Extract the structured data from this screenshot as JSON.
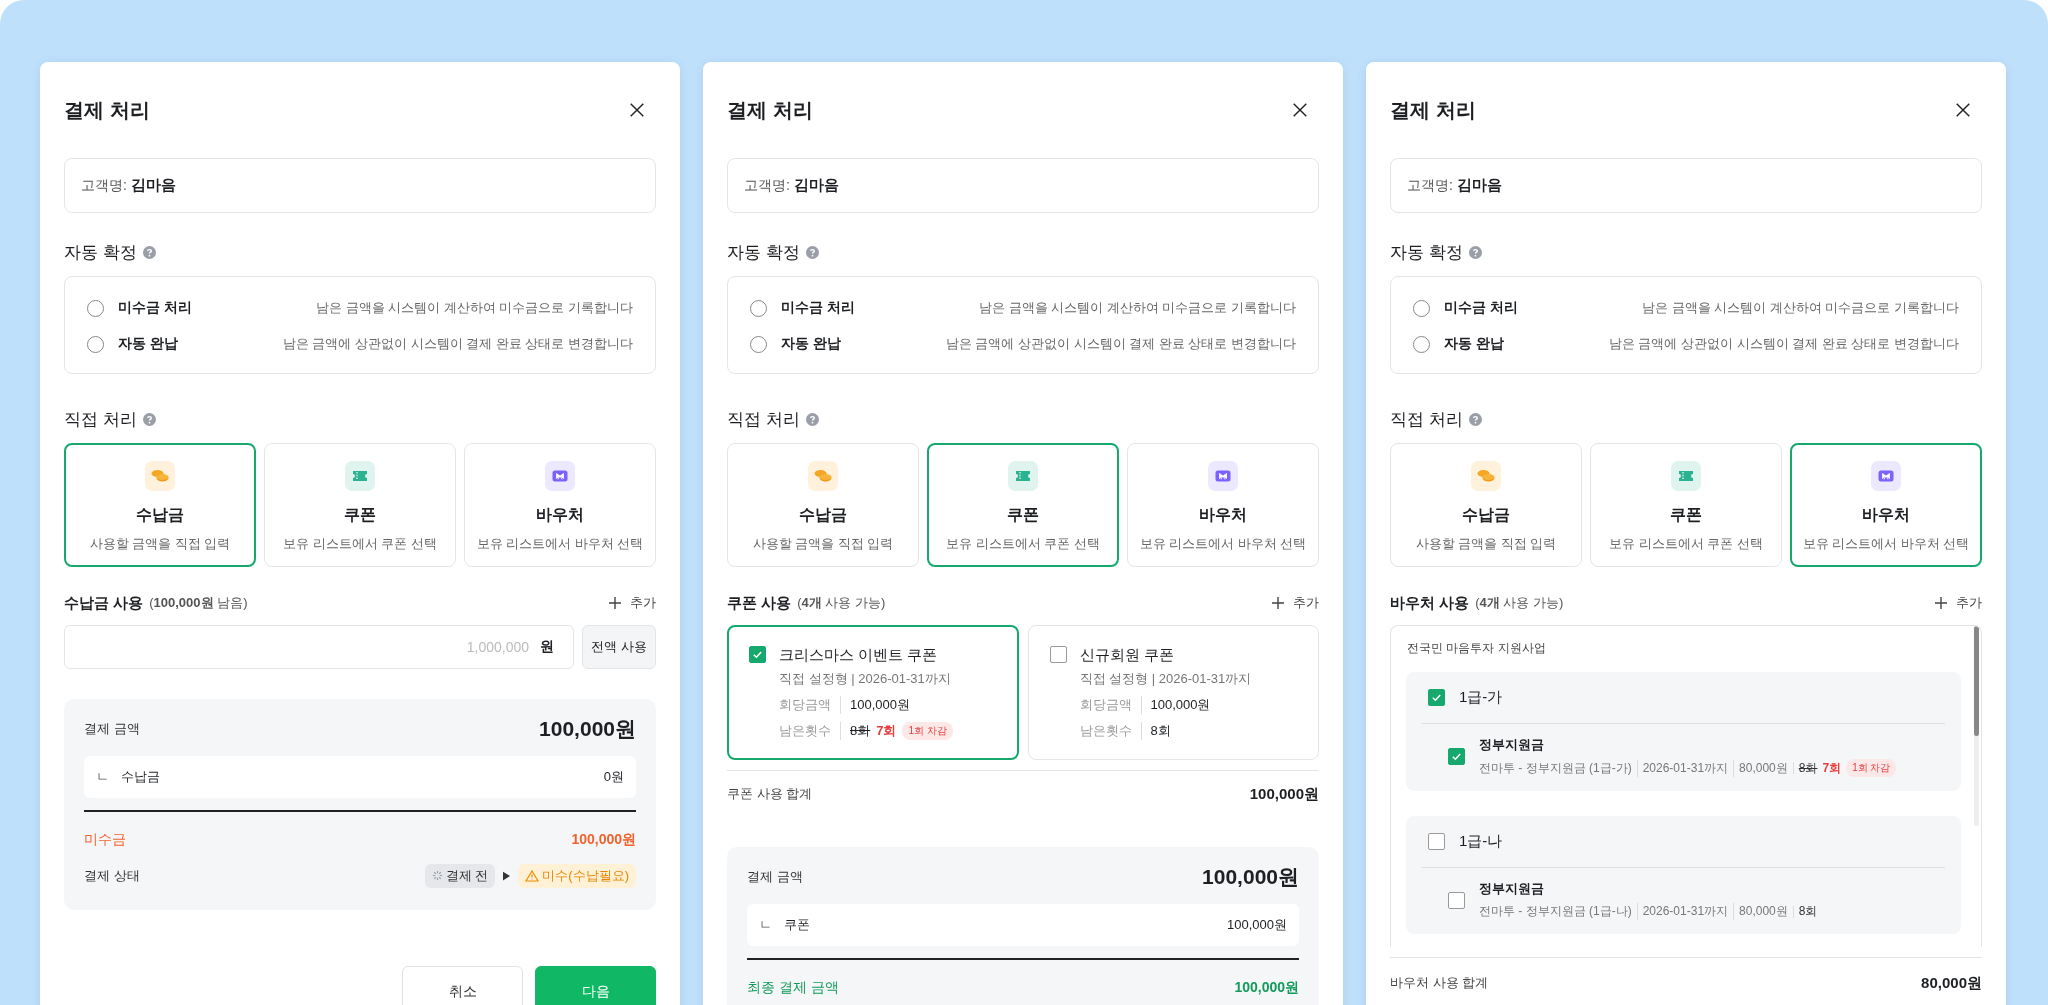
{
  "panels": [
    {
      "title": "결제 처리",
      "customer": {
        "label": "고객명:",
        "name": "김마음"
      },
      "auto": {
        "title": "자동 확정",
        "options": [
          {
            "label": "미수금 처리",
            "description": "남은 금액을 시스템이 계산하여 미수금으로 기록합니다",
            "selected": false
          },
          {
            "label": "자동 완납",
            "description": "남은 금액에 상관없이 시스템이 결제 완료 상태로 변경합니다",
            "selected": false
          }
        ]
      },
      "direct": {
        "title": "직접 처리",
        "methods": [
          {
            "kind": "coins",
            "label": "수납금",
            "description": "사용할 금액을 직접 입력",
            "selected": true
          },
          {
            "kind": "ticket",
            "label": "쿠폰",
            "description": "보유 리스트에서 쿠폰 선택",
            "selected": false
          },
          {
            "kind": "voucher",
            "label": "바우처",
            "description": "보유 리스트에서 바우처 선택",
            "selected": false
          }
        ]
      },
      "usage": {
        "kind": "amount",
        "title": "수납금 사용",
        "note": "(**100,000원** 남음)",
        "add": "추가",
        "input": {
          "placeholder": "1,000,000",
          "unit": "원"
        },
        "full_button": "전액 사용"
      },
      "summary": {
        "label": "결제 금액",
        "total": "100,000원",
        "lines": [
          {
            "marker": "ㄴ",
            "label": "수납금",
            "value": "0원"
          }
        ],
        "result": {
          "kind": "unpaid",
          "label": "미수금",
          "value": "100,000원"
        },
        "status": {
          "label": "결제 상태",
          "from": "결제 전",
          "to": "미수(수납필요)"
        }
      },
      "buttons": [
        {
          "kind": "secondary",
          "label": "취소"
        },
        {
          "kind": "primary",
          "label": "다음"
        }
      ]
    },
    {
      "title": "결제 처리",
      "customer": {
        "label": "고객명:",
        "name": "김마음"
      },
      "auto": {
        "title": "자동 확정",
        "options": [
          {
            "label": "미수금 처리",
            "description": "남은 금액을 시스템이 계산하여 미수금으로 기록합니다",
            "selected": false
          },
          {
            "label": "자동 완납",
            "description": "남은 금액에 상관없이 시스템이 결제 완료 상태로 변경합니다",
            "selected": false
          }
        ]
      },
      "direct": {
        "title": "직접 처리",
        "methods": [
          {
            "kind": "coins",
            "label": "수납금",
            "description": "사용할 금액을 직접 입력",
            "selected": false
          },
          {
            "kind": "ticket",
            "label": "쿠폰",
            "description": "보유 리스트에서 쿠폰 선택",
            "selected": true
          },
          {
            "kind": "voucher",
            "label": "바우처",
            "description": "보유 리스트에서 바우처 선택",
            "selected": false
          }
        ]
      },
      "usage": {
        "kind": "coupon",
        "title": "쿠폰 사용",
        "note": "(**4개** 사용 가능)",
        "add": "추가",
        "coupons": [
          {
            "name": "크리스마스 이벤트 쿠폰",
            "meta": "직접 설정형 | 2026-01-31까지",
            "amount_label": "회당금액",
            "amount": "100,000원",
            "remaining_label": "남은횟수",
            "remaining_before": "8회",
            "remaining": "7회",
            "deduction": "1회 차감",
            "checked": true
          },
          {
            "name": "신규회원 쿠폰",
            "meta": "직접 설정형 | 2026-01-31까지",
            "amount_label": "회당금액",
            "amount": "100,000원",
            "remaining_label": "남은횟수",
            "remaining": "8회",
            "checked": false
          }
        ],
        "total_label": "쿠폰 사용 합계",
        "total": "100,000원"
      },
      "summary": {
        "label": "결제 금액",
        "total": "100,000원",
        "lines": [
          {
            "marker": "ㄴ",
            "label": "쿠폰",
            "value": "100,000원"
          }
        ],
        "result": {
          "kind": "final",
          "label": "최종 결제 금액",
          "value": "100,000원"
        }
      }
    },
    {
      "title": "결제 처리",
      "customer": {
        "label": "고객명:",
        "name": "김마음"
      },
      "auto": {
        "title": "자동 확정",
        "options": [
          {
            "label": "미수금 처리",
            "description": "남은 금액을 시스템이 계산하여 미수금으로 기록합니다",
            "selected": false
          },
          {
            "label": "자동 완납",
            "description": "남은 금액에 상관없이 시스템이 결제 완료 상태로 변경합니다",
            "selected": false
          }
        ]
      },
      "direct": {
        "title": "직접 처리",
        "methods": [
          {
            "kind": "coins",
            "label": "수납금",
            "description": "사용할 금액을 직접 입력",
            "selected": false
          },
          {
            "kind": "ticket",
            "label": "쿠폰",
            "description": "보유 리스트에서 쿠폰 선택",
            "selected": false
          },
          {
            "kind": "voucher",
            "label": "바우처",
            "description": "보유 리스트에서 바우처 선택",
            "selected": true
          }
        ]
      },
      "usage": {
        "kind": "voucher",
        "title": "바우처 사용",
        "note": "(**4개** 사용 가능)",
        "add": "추가",
        "program": "전국민 마음투자 지원사업",
        "groups": [
          {
            "name": "1급-가",
            "checked": true,
            "items": [
              {
                "name": "정부지원금",
                "source": "전마투 - 정부지원금 (1급-가)",
                "expiry": "2026-01-31까지",
                "amount": "80,000원",
                "remaining_before": "8회",
                "remaining": "7회",
                "deduction": "1회 차감",
                "checked": true
              }
            ]
          },
          {
            "name": "1급-나",
            "checked": false,
            "items": [
              {
                "name": "정부지원금",
                "source": "전마투 - 정부지원금 (1급-나)",
                "expiry": "2026-01-31까지",
                "amount": "80,000원",
                "remaining": "8회",
                "checked": false
              }
            ]
          }
        ],
        "total_label": "바우처 사용 합계",
        "total": "80,000원"
      }
    }
  ]
}
